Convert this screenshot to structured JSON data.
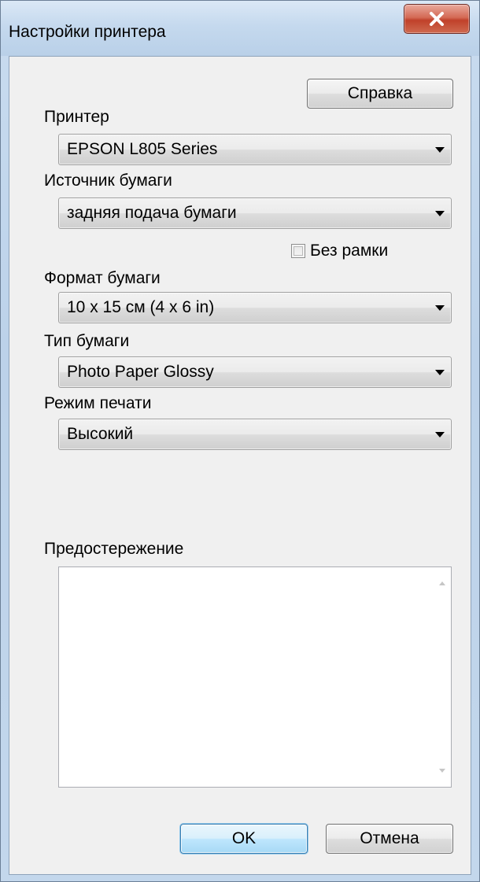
{
  "window": {
    "title": "Настройки принтера"
  },
  "help_button": {
    "label": "Справка"
  },
  "printer": {
    "label": "Принтер",
    "selected": "EPSON L805 Series"
  },
  "paper_source": {
    "label": "Источник бумаги",
    "selected": "задняя подача бумаги"
  },
  "borderless": {
    "label": "Без рамки",
    "checked": false
  },
  "paper_size": {
    "label": "Формат бумаги",
    "selected": "10 x 15 см (4 x 6 in)"
  },
  "paper_type": {
    "label": "Тип бумаги",
    "selected": "Photo Paper Glossy"
  },
  "print_mode": {
    "label": "Режим печати",
    "selected": "Высокий"
  },
  "warning": {
    "label": "Предостережение",
    "text": ""
  },
  "footer": {
    "ok_label": "OK",
    "cancel_label": "Отмена"
  },
  "icons": {
    "close": "close-icon",
    "dropdown": "chevron-down-icon",
    "scroll_up": "scroll-up-arrow-icon",
    "scroll_down": "scroll-down-arrow-icon"
  },
  "colors": {
    "close_button": "#c7432d",
    "default_button_border": "#3c7fb1",
    "dialog_background": "#f0f0f0"
  }
}
